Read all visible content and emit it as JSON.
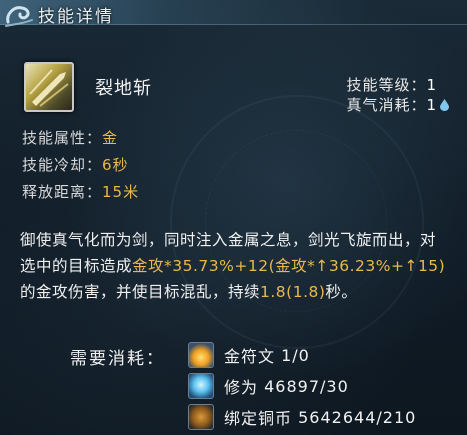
{
  "window": {
    "title": "技能详情"
  },
  "skill": {
    "name": "裂地斩",
    "level_label": "技能等级：",
    "level_value": "1",
    "qi_cost_label": "真气消耗：",
    "qi_cost_value": "1",
    "attribute_label": "技能属性：",
    "attribute_value": "金",
    "cooldown_label": "技能冷却：",
    "cooldown_value": "6秒",
    "range_label": "释放距离：",
    "range_value": "15米"
  },
  "description": {
    "part1": "御使真气化而为剑，同时注入金属之息，剑光飞旋而出，对选中的目标造成",
    "formula": "金攻*35.73%+12(金攻*↑36.23%+↑15)",
    "part2": "的金攻伤害，并使目标混乱，持续",
    "duration": "1.8(1.8)",
    "part3": "秒。"
  },
  "cost": {
    "label": "需要消耗：",
    "items": [
      {
        "icon": "golden-rune-icon",
        "name": "金符文",
        "amount": "1/0"
      },
      {
        "icon": "cultivation-crystal-icon",
        "name": "修为",
        "amount": "46897/30"
      },
      {
        "icon": "bound-copper-coin-icon",
        "name": "绑定铜币",
        "amount": "5642644/210"
      }
    ]
  },
  "colors": {
    "accent_gold": "#e9b94a",
    "text": "#f0f0f0",
    "background": "#101c27"
  }
}
